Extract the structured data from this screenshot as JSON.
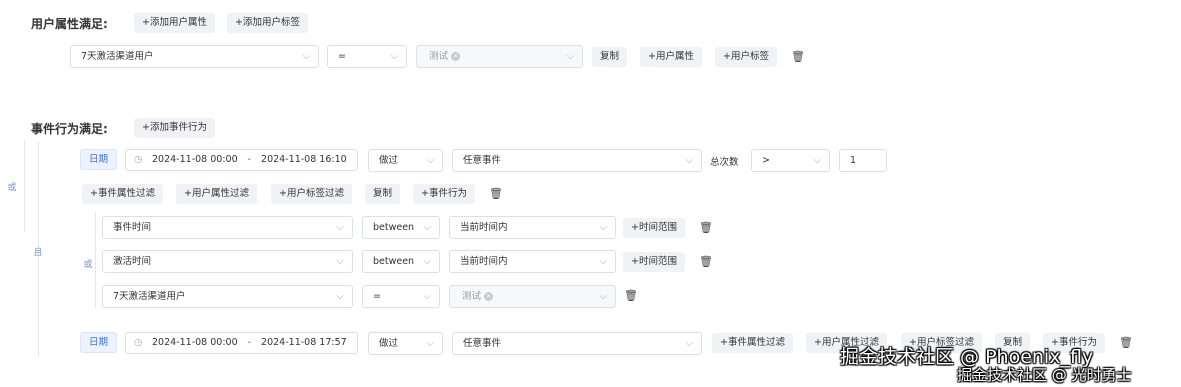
{
  "user_attr": {
    "title": "用户属性满足:",
    "add_attr_btn": "+添加用户属性",
    "add_tag_btn": "+添加用户标签",
    "row": {
      "field": "7天激活渠道用户",
      "operator": "=",
      "value_tag": "测试",
      "copy": "复制",
      "add_attr": "+用户属性",
      "add_tag": "+用户标签"
    }
  },
  "event": {
    "title": "事件行为满足:",
    "add_event_btn": "+添加事件行为",
    "outer_or": "或",
    "outer_and": "且",
    "group1": {
      "date_label": "日期",
      "date_start": "2024-11-08 00:00",
      "date_sep": "-",
      "date_end": "2024-11-08 16:10",
      "action": "做过",
      "event_name": "任意事件",
      "metric": "总次数",
      "compare": ">",
      "count": "1",
      "filters": [
        "+事件属性过滤",
        "+用户属性过滤",
        "+用户标签过滤",
        "复制",
        "+事件行为"
      ],
      "inner_or": "或",
      "conditions": [
        {
          "field": "事件时间",
          "op": "between",
          "value": "当前时间内",
          "extra": "+时间范围"
        },
        {
          "field": "激活时间",
          "op": "between",
          "value": "当前时间内",
          "extra": "+时间范围"
        },
        {
          "field": "7天激活渠道用户",
          "op": "=",
          "value_tag": "测试"
        }
      ]
    },
    "group2": {
      "date_label": "日期",
      "date_start": "2024-11-08 00:00",
      "date_sep": "-",
      "date_end": "2024-11-08 17:57",
      "action": "做过",
      "event_name": "任意事件",
      "filters": [
        "+事件属性过滤",
        "+用户属性过滤",
        "+用户标签过滤",
        "复制",
        "+事件行为"
      ]
    }
  },
  "icons": {
    "dropdown": "chevron-down-icon",
    "delete": "trash-icon",
    "calendar": "calendar-icon",
    "tag_remove": "close-circle-icon"
  },
  "colors": {
    "accent": "#4a6fd8",
    "button_bg": "#f0f2f5",
    "border": "#dcdfe6"
  },
  "watermark": {
    "line1": "掘金技术社区 @ Phoenix_fly",
    "line2": "掘金技术社区 @ 光时勇士"
  }
}
